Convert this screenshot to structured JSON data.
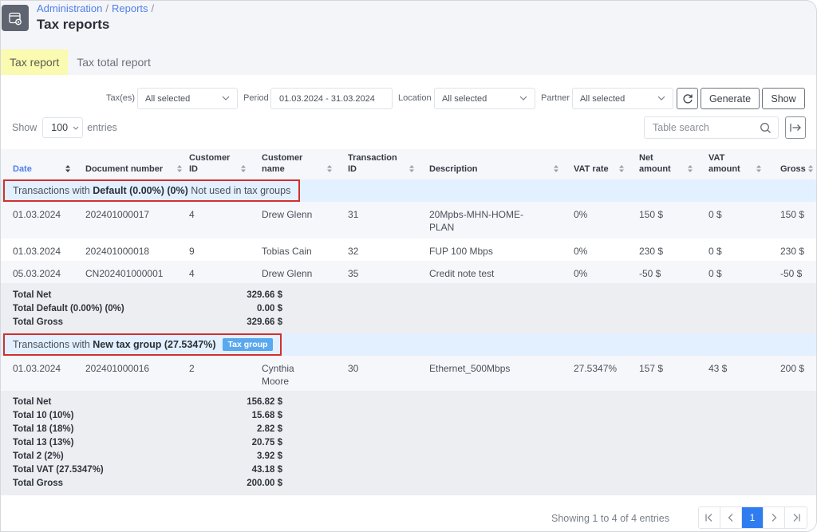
{
  "header": {
    "breadcrumb": [
      {
        "label": "Administration"
      },
      {
        "label": "Reports"
      }
    ],
    "breadcrumb_separator": "/",
    "title": "Tax reports",
    "icon": "report-window-icon"
  },
  "tabs": [
    {
      "label": "Tax report",
      "active": true
    },
    {
      "label": "Tax total report",
      "active": false
    }
  ],
  "filters": {
    "taxes_label": "Tax(es)",
    "taxes_value": "All selected",
    "period_label": "Period",
    "period_value": "01.03.2024 - 31.03.2024",
    "location_label": "Location",
    "location_value": "All selected",
    "partner_label": "Partner",
    "partner_value": "All selected",
    "refresh_icon": "refresh-icon",
    "generate_label": "Generate",
    "show_label": "Show"
  },
  "entries": {
    "show_label": "Show",
    "value": "100",
    "entries_label": "entries"
  },
  "search": {
    "placeholder": "Table search",
    "icon": "search-icon"
  },
  "export_icon": "export-icon",
  "table": {
    "columns": [
      {
        "label": "Date",
        "sorted": true
      },
      {
        "label": "Document number"
      },
      {
        "label": "Customer ID"
      },
      {
        "label": "Customer name"
      },
      {
        "label": "Transaction ID"
      },
      {
        "label": "Description"
      },
      {
        "label": "VAT rate"
      },
      {
        "label": "Net amount"
      },
      {
        "label": "VAT amount"
      },
      {
        "label": "Gross"
      }
    ],
    "groups": [
      {
        "prefix": "Transactions with",
        "name": "Default (0.00%) (0%)",
        "suffix": "Not used in tax groups",
        "badge": null,
        "rows": [
          {
            "date": "01.03.2024",
            "document": "202401000017",
            "customer_id": "4",
            "customer_name": "Drew Glenn",
            "transaction_id": "31",
            "description": "20Mpbs-MHN-HOME-PLAN",
            "vat_rate": "0%",
            "net": "150 $",
            "vat": "0 $",
            "gross": "150 $"
          },
          {
            "date": "01.03.2024",
            "document": "202401000018",
            "customer_id": "9",
            "customer_name": "Tobias Cain",
            "transaction_id": "32",
            "description": "FUP 100 Mbps",
            "vat_rate": "0%",
            "net": "230 $",
            "vat": "0 $",
            "gross": "230 $"
          },
          {
            "date": "05.03.2024",
            "document": "CN202401000001",
            "customer_id": "4",
            "customer_name": "Drew Glenn",
            "transaction_id": "35",
            "description": "Credit note test",
            "vat_rate": "0%",
            "net": "-50 $",
            "vat": "0 $",
            "gross": "-50 $"
          }
        ],
        "totals": [
          {
            "label": "Total Net",
            "value": "329.66 $"
          },
          {
            "label": "Total Default (0.00%) (0%)",
            "value": "0.00 $"
          },
          {
            "label": "Total Gross",
            "value": "329.66 $"
          }
        ]
      },
      {
        "prefix": "Transactions with",
        "name": "New tax group (27.5347%)",
        "suffix": "",
        "badge": "Tax group",
        "rows": [
          {
            "date": "01.03.2024",
            "document": "202401000016",
            "customer_id": "2",
            "customer_name": "Cynthia Moore",
            "transaction_id": "30",
            "description": "Ethernet_500Mbps",
            "vat_rate": "27.5347%",
            "net": "157 $",
            "vat": "43 $",
            "gross": "200 $"
          }
        ],
        "totals": [
          {
            "label": "Total Net",
            "value": "156.82 $"
          },
          {
            "label": "Total 10 (10%)",
            "value": "15.68 $"
          },
          {
            "label": "Total 18 (18%)",
            "value": "2.82 $"
          },
          {
            "label": "Total 13 (13%)",
            "value": "20.75 $"
          },
          {
            "label": "Total 2 (2%)",
            "value": "3.92 $"
          },
          {
            "label": "Total VAT (27.5347%)",
            "value": "43.18 $"
          },
          {
            "label": "Total Gross",
            "value": "200.00 $"
          }
        ]
      }
    ]
  },
  "footer": {
    "info": "Showing 1 to 4 of 4 entries",
    "current_page": "1"
  },
  "colors": {
    "accent": "#2f7cf0",
    "link": "#4f7fe8",
    "active_tab": "#fafab0",
    "group_row": "#e3f0ff",
    "highlight_border": "#d32f2f",
    "badge": "#5aa8ee",
    "totals_bg": "#eceef2"
  }
}
